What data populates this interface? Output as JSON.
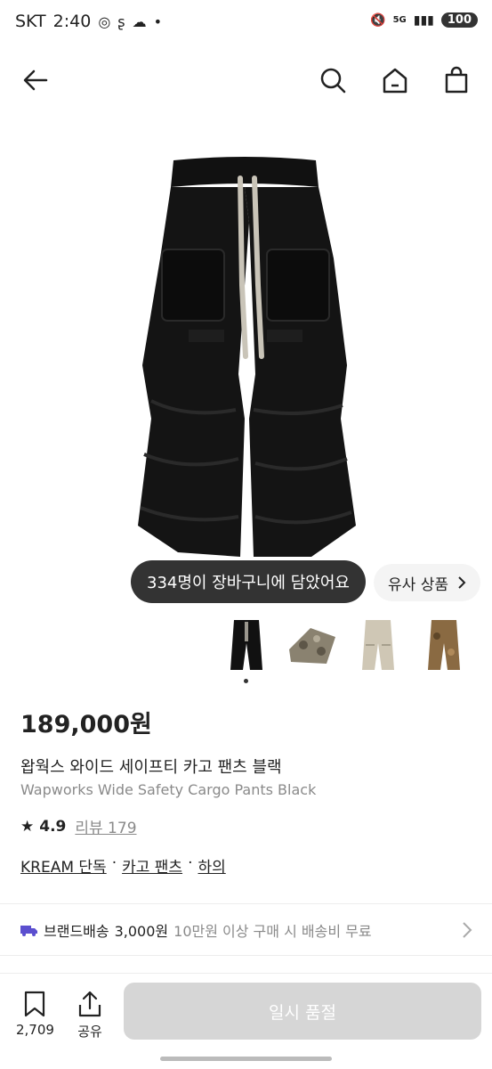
{
  "status_bar": {
    "carrier": "SKT",
    "time": "2:40",
    "network": "5G",
    "battery": "100"
  },
  "nav": {
    "icons": [
      "back-arrow-icon",
      "search-icon",
      "home-icon",
      "shopping-bag-icon"
    ]
  },
  "product": {
    "cart_count_text": "334명이 장바구니에 담았어요",
    "similar_label": "유사 상품",
    "price": "189,000원",
    "name_ko": "왑웍스 와이드 세이프티 카고 팬츠 블랙",
    "name_en": "Wapworks Wide Safety Cargo Pants Black",
    "rating": "4.9",
    "review_label": "리뷰 179",
    "tags": [
      "KREAM 단독",
      "카고 팬츠",
      "하의"
    ],
    "tag_separator": "·"
  },
  "shipping": {
    "label": "브랜드배송",
    "fee": "3,000원",
    "note": "10만원 이상 구매 시 배송비 무료"
  },
  "bottom_bar": {
    "save_count": "2,709",
    "share_label": "공유",
    "cta_label": "일시 품절"
  },
  "colors": {
    "pants": "#111111",
    "drawcord": "#c9c4b8",
    "camo": "#8a8270",
    "beige": "#cfc7b5",
    "brown": "#8a6a42",
    "shipping_truck": "#5b4fcf"
  }
}
